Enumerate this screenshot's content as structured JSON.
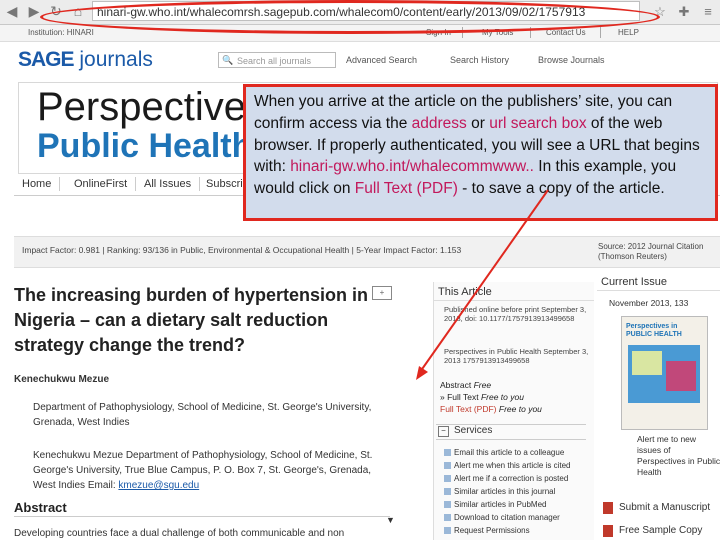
{
  "browser": {
    "url": "hinari-gw.who.int/whalecomrsh.sagepub.com/whalecom0/content/early/2013/09/02/1757913",
    "back_icon": "back-arrow-icon",
    "forward_icon": "forward-arrow-icon",
    "reload_icon": "reload-icon"
  },
  "topbar": {
    "institution": "Institution: HINARI",
    "sign_in": "Sign In",
    "my_tools": "My Tools",
    "contact_us": "Contact Us",
    "help": "HELP"
  },
  "header": {
    "logo_sage": "SAGE",
    "logo_journals": "journals",
    "search_placeholder": "Search all journals",
    "advanced_search": "Advanced Search",
    "search_history": "Search History",
    "browse_journals": "Browse Journals"
  },
  "banner": {
    "line1": "Perspectives in",
    "line2": "Public Health"
  },
  "nav": {
    "tabs": [
      "Home",
      "OnlineFirst",
      "All Issues",
      "Subscribe"
    ]
  },
  "impact": {
    "text": "Impact Factor: 0.981 | Ranking: 93/136 in Public, Environmental & Occupational Health | 5-Year Impact Factor: 1.153",
    "source_line1": "Source: 2012 Journal Citation",
    "source_line2": "(Thomson Reuters)"
  },
  "article": {
    "title": "The increasing burden of hypertension in Nigeria – can a dietary salt reduction strategy change the trend?",
    "author": "Kenechukwu Mezue",
    "affiliation1": "Department of Pathophysiology, School of Medicine, St. George's University, Grenada, West Indies",
    "affiliation2_prefix": "Kenechukwu Mezue Department of Pathophysiology, School of Medicine, St. George's University, True Blue Campus, P. O. Box 7, St. George's, Grenada, West Indies Email:",
    "email": "kmezue@sgu.edu",
    "abstract_heading": "Abstract",
    "abstract_text": "Developing countries face a dual challenge of both communicable and non"
  },
  "this_article": {
    "heading": "This Article",
    "pub_info": "Published online before print September 3, 2013, doi: 10.1177/1757913913499658",
    "journal_info": "Perspectives in Public Health September 3, 2013 1757913913499658",
    "abstract_label": "Abstract",
    "abstract_free": "Free",
    "full_text_label": "» Full Text",
    "full_text_free": "Free to you",
    "full_text_pdf": "Full Text (PDF)",
    "full_text_pdf_free": "Free to you",
    "services_heading": "Services",
    "services": [
      "Email this article to a colleague",
      "Alert me when this article is cited",
      "Alert me if a correction is posted",
      "Similar articles in this journal",
      "Similar articles in PubMed",
      "Download to citation manager",
      "Request Permissions"
    ]
  },
  "current_issue": {
    "heading": "Current Issue",
    "date": "November 2013, 133",
    "cover_title": "Perspectives in PUBLIC HEALTH",
    "alert_text": "Alert me to new issues of Perspectives in Public Health",
    "submit_manuscript": "Submit a Manuscript",
    "free_sample": "Free Sample Copy"
  },
  "overlay": {
    "text_1": "When you arrive at the article on the publishers’ site, you can confirm access via the ",
    "highlight_1": "address",
    "text_2": " or ",
    "highlight_2": "url search box",
    "text_3": " of the web browser.  If properly authenticated, you will see a URL that begins with: ",
    "highlight_3": "hinari-gw.who.int/whalecommwww..",
    "text_4": " In this example, you would click on ",
    "highlight_4": "Full Text (PDF)",
    "text_5": " - to save a copy of the article."
  },
  "colors": {
    "annotation_red": "#e0281f",
    "overlay_bg": "#d2dcec",
    "highlight": "#c2185b",
    "brand_blue": "#1b5aa8"
  }
}
